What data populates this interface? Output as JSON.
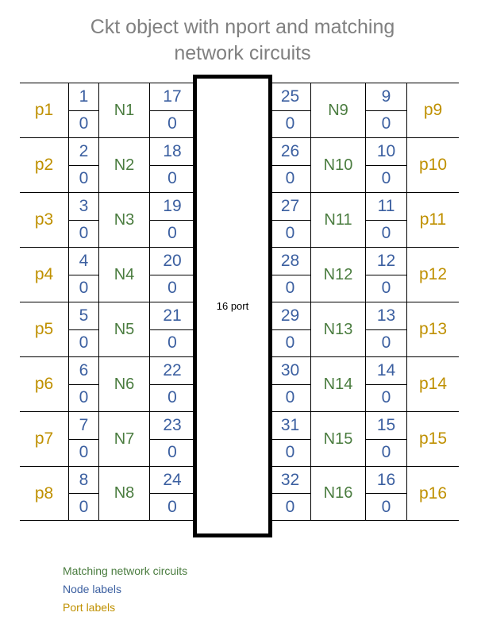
{
  "title": {
    "line1": "Ckt object with nport and matching",
    "line2": "network circuits"
  },
  "nport_box": {
    "label": "16 port"
  },
  "left_rows": [
    {
      "port": "p1",
      "node_a_top": "1",
      "node_a_bottom": "0",
      "nname": "N1",
      "node_b_top": "17",
      "node_b_bottom": "0"
    },
    {
      "port": "p2",
      "node_a_top": "2",
      "node_a_bottom": "0",
      "nname": "N2",
      "node_b_top": "18",
      "node_b_bottom": "0"
    },
    {
      "port": "p3",
      "node_a_top": "3",
      "node_a_bottom": "0",
      "nname": "N3",
      "node_b_top": "19",
      "node_b_bottom": "0"
    },
    {
      "port": "p4",
      "node_a_top": "4",
      "node_a_bottom": "0",
      "nname": "N4",
      "node_b_top": "20",
      "node_b_bottom": "0"
    },
    {
      "port": "p5",
      "node_a_top": "5",
      "node_a_bottom": "0",
      "nname": "N5",
      "node_b_top": "21",
      "node_b_bottom": "0"
    },
    {
      "port": "p6",
      "node_a_top": "6",
      "node_a_bottom": "0",
      "nname": "N6",
      "node_b_top": "22",
      "node_b_bottom": "0"
    },
    {
      "port": "p7",
      "node_a_top": "7",
      "node_a_bottom": "0",
      "nname": "N7",
      "node_b_top": "23",
      "node_b_bottom": "0"
    },
    {
      "port": "p8",
      "node_a_top": "8",
      "node_a_bottom": "0",
      "nname": "N8",
      "node_b_top": "24",
      "node_b_bottom": "0"
    }
  ],
  "right_rows": [
    {
      "node_a_top": "25",
      "node_a_bottom": "0",
      "nname": "N9",
      "node_b_top": "9",
      "node_b_bottom": "0",
      "port": "p9"
    },
    {
      "node_a_top": "26",
      "node_a_bottom": "0",
      "nname": "N10",
      "node_b_top": "10",
      "node_b_bottom": "0",
      "port": "p10"
    },
    {
      "node_a_top": "27",
      "node_a_bottom": "0",
      "nname": "N11",
      "node_b_top": "11",
      "node_b_bottom": "0",
      "port": "p11"
    },
    {
      "node_a_top": "28",
      "node_a_bottom": "0",
      "nname": "N12",
      "node_b_top": "12",
      "node_b_bottom": "0",
      "port": "p12"
    },
    {
      "node_a_top": "29",
      "node_a_bottom": "0",
      "nname": "N13",
      "node_b_top": "13",
      "node_b_bottom": "0",
      "port": "p13"
    },
    {
      "node_a_top": "30",
      "node_a_bottom": "0",
      "nname": "N14",
      "node_b_top": "14",
      "node_b_bottom": "0",
      "port": "p14"
    },
    {
      "node_a_top": "31",
      "node_a_bottom": "0",
      "nname": "N15",
      "node_b_top": "15",
      "node_b_bottom": "0",
      "port": "p15"
    },
    {
      "node_a_top": "32",
      "node_a_bottom": "0",
      "nname": "N16",
      "node_b_top": "16",
      "node_b_bottom": "0",
      "port": "p16"
    }
  ],
  "legend": [
    {
      "text": "Matching network circuits",
      "color": "#4A7C3F"
    },
    {
      "text": "Node labels",
      "color": "#3B5FA0"
    },
    {
      "text": "Port labels",
      "color": "#BF9000"
    }
  ],
  "colors": {
    "node_blue": "#3B5FA0",
    "network_green": "#4A7C3F",
    "port_gold": "#BF9000",
    "title_gray": "#808080",
    "rule_black": "#000000"
  }
}
